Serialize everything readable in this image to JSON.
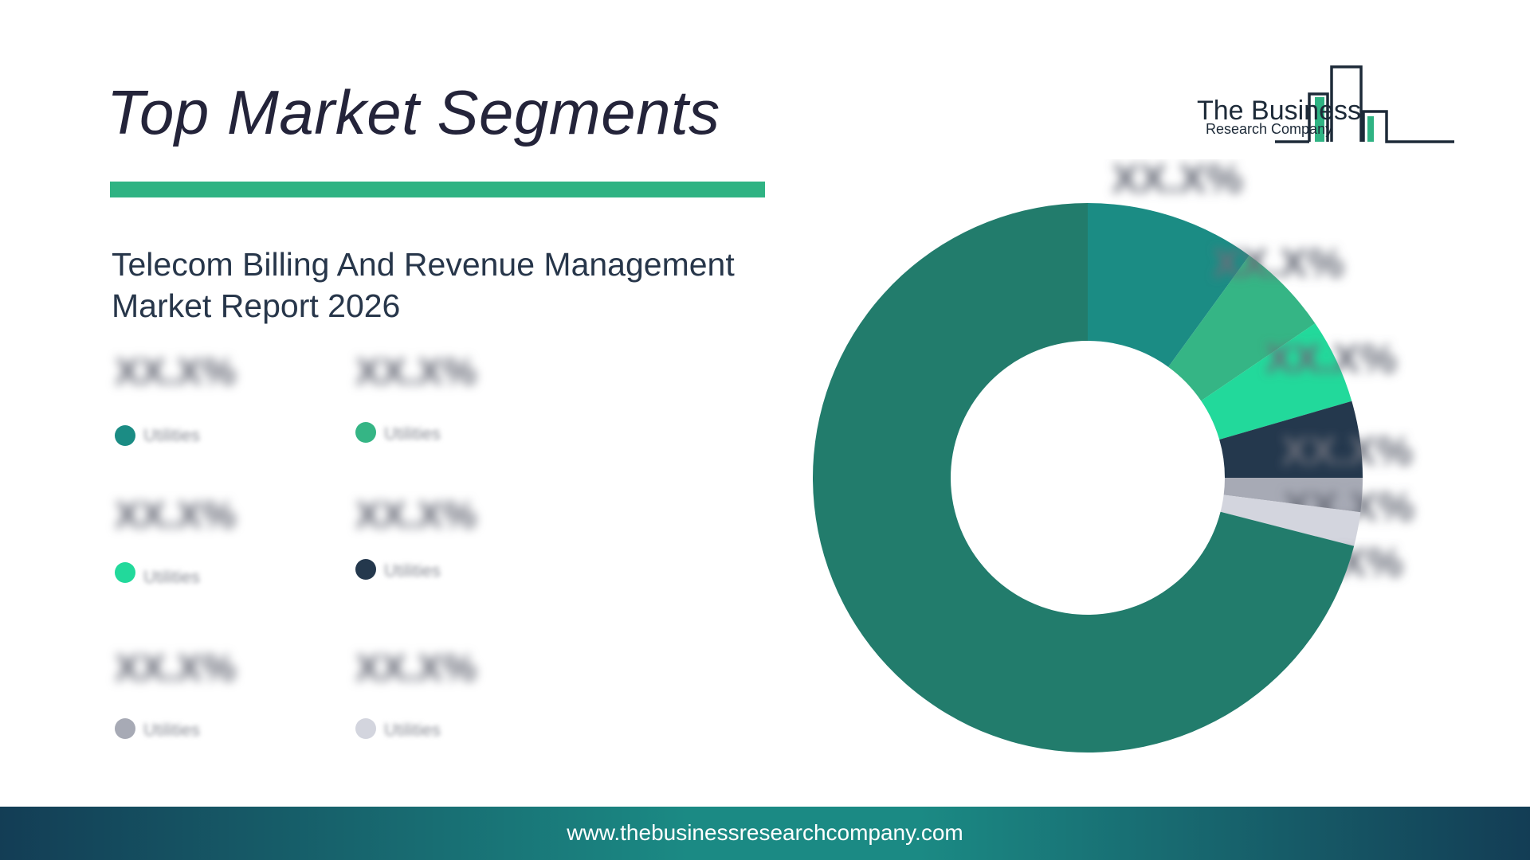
{
  "header": {
    "title": "Top Market Segments",
    "report_title": "Telecom Billing And Revenue Management Market Report 2026"
  },
  "logo": {
    "line1": "The Business",
    "line2": "Research Company",
    "color_dark": "#1d2a38",
    "color_accent": "#2fb383"
  },
  "legend": {
    "items": [
      {
        "value": "XX.X%",
        "label": "Utilities",
        "color": "#1b8c84"
      },
      {
        "value": "XX.X%",
        "label": "Utilities",
        "color": "#35b585"
      },
      {
        "value": "XX.X%",
        "label": "Utilities",
        "color": "#22d99b"
      },
      {
        "value": "XX.X%",
        "label": "Utilities",
        "color": "#24384d"
      },
      {
        "value": "XX.X%",
        "label": "Utilities",
        "color": "#a7aab5"
      },
      {
        "value": "XX.X%",
        "label": "Utilities",
        "color": "#d3d5de"
      }
    ]
  },
  "chart_data": {
    "type": "pie",
    "donut": true,
    "title": "",
    "legend": "left",
    "slices": [
      {
        "label": "",
        "value": 10.0,
        "color": "#1b8c84",
        "display": "XX.X%"
      },
      {
        "label": "",
        "value": 5.5,
        "color": "#35b585",
        "display": "XX.X%"
      },
      {
        "label": "",
        "value": 5.0,
        "color": "#22d99b",
        "display": "XX.X%"
      },
      {
        "label": "",
        "value": 4.5,
        "color": "#24384d",
        "display": "XX.X%"
      },
      {
        "label": "",
        "value": 2.0,
        "color": "#a7aab5",
        "display": "XX.X%"
      },
      {
        "label": "",
        "value": 2.0,
        "color": "#d3d5de",
        "display": "XX.X%"
      },
      {
        "label": "",
        "value": 71.0,
        "color": "#227c6c",
        "display": ""
      }
    ]
  },
  "footer": {
    "url": "www.thebusinessresearchcompany.com"
  }
}
